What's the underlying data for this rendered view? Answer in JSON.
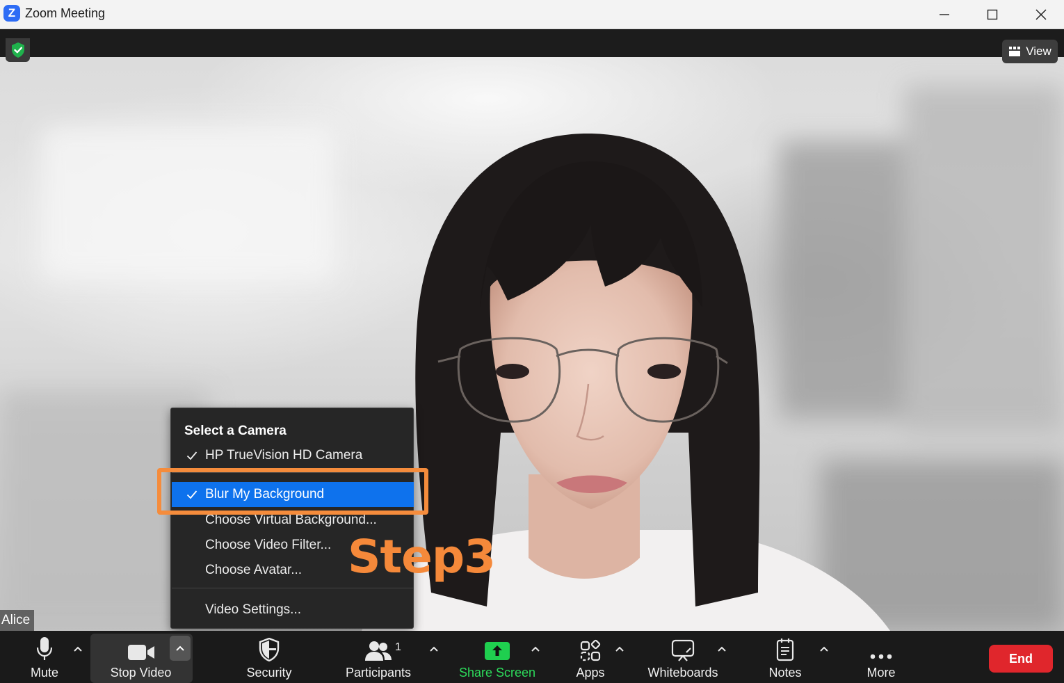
{
  "window": {
    "title": "Zoom Meeting",
    "app_icon_letter": "Z"
  },
  "header": {
    "view_label": "View",
    "security_status": "encrypted"
  },
  "video": {
    "participant_name": "Alice"
  },
  "camera_menu": {
    "heading": "Select a Camera",
    "items": [
      {
        "label": "HP TrueVision HD Camera",
        "checked": true,
        "selected": false
      },
      {
        "label": "Blur My Background",
        "checked": true,
        "selected": true
      },
      {
        "label": "Choose Virtual Background...",
        "checked": false,
        "selected": false
      },
      {
        "label": "Choose Video Filter...",
        "checked": false,
        "selected": false
      },
      {
        "label": "Choose Avatar...",
        "checked": false,
        "selected": false
      },
      {
        "label": "Video Settings...",
        "checked": false,
        "selected": false
      }
    ]
  },
  "annotation": {
    "step_label": "Step3",
    "color": "#f58c3c"
  },
  "toolbar": {
    "mute": "Mute",
    "stop_video": "Stop Video",
    "security": "Security",
    "participants": "Participants",
    "participants_count": "1",
    "share_screen": "Share Screen",
    "apps": "Apps",
    "whiteboards": "Whiteboards",
    "notes": "Notes",
    "more": "More",
    "end": "End"
  },
  "colors": {
    "accent": "#0e72ed",
    "share": "#2ddc5b",
    "end": "#e0262c",
    "shield": "#1fb24c"
  }
}
